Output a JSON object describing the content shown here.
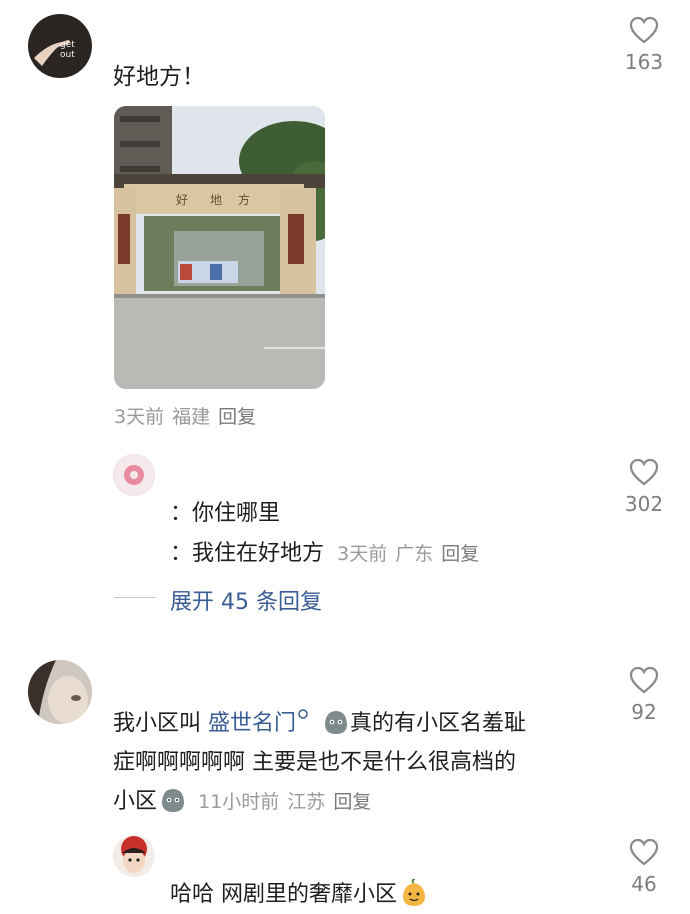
{
  "c1": {
    "avatar_text": "get out",
    "text": "好地方！",
    "likes": "163",
    "meta": {
      "time": "3天前",
      "loc": "福建",
      "reply": "回复"
    }
  },
  "r1": {
    "line1": "：你住哪里",
    "line2": "：我住在好地方",
    "likes": "302",
    "meta": {
      "time": "3天前",
      "loc": "广东",
      "reply": "回复"
    }
  },
  "expand": {
    "label": "展开 45 条回复"
  },
  "c2": {
    "pre": "我小区叫 ",
    "link": "盛世名门",
    "post": "真的有小区名羞耻",
    "line2": "症啊啊啊啊啊 主要是也不是什么很高档的",
    "line3": "小区",
    "likes": "92",
    "meta": {
      "time": "11小时前",
      "loc": "江苏",
      "reply": "回复"
    }
  },
  "r2": {
    "text": "哈哈 网剧里的奢靡小区",
    "likes": "46"
  },
  "colors": {
    "link": "#3a5e93",
    "meta": "#9a9a9a",
    "text": "#1f1f1f"
  }
}
